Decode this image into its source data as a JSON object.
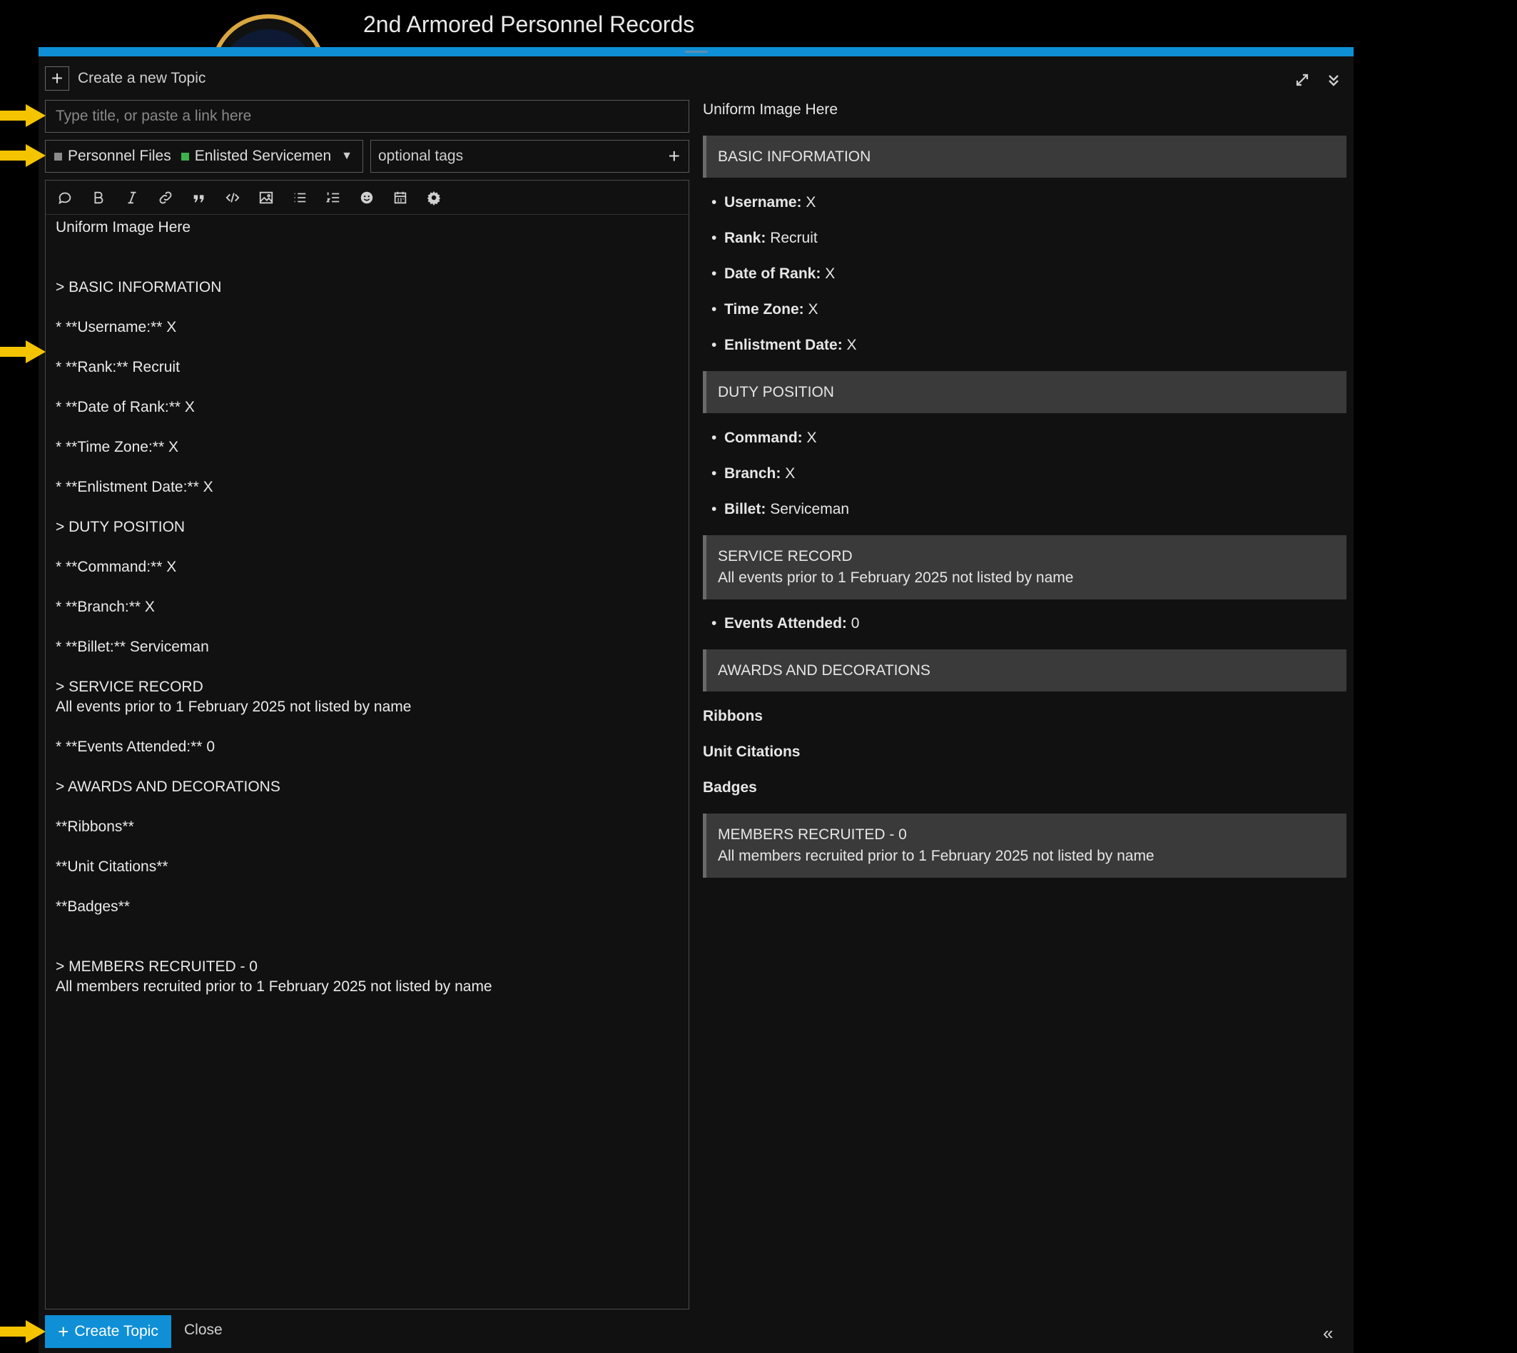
{
  "site": {
    "title": "2nd Armored Personnel Records"
  },
  "composer": {
    "action_label": "Create a new Topic",
    "title_placeholder": "Type title, or paste a link here",
    "category": {
      "parent": "Personnel Files",
      "child": "Enlisted Servicemen",
      "parent_color": "#8a8a8a",
      "child_color": "#3cb34a"
    },
    "tags_placeholder": "optional tags",
    "toolbar_icons": [
      "quote-icon",
      "bold-icon",
      "italic-icon",
      "link-icon",
      "blockquote-icon",
      "code-icon",
      "image-icon",
      "bullet-list-icon",
      "numbered-list-icon",
      "emoji-icon",
      "calendar-icon",
      "gear-icon"
    ],
    "editor_text": "Uniform Image Here\n\n\n> BASIC INFORMATION\n\n* **Username:** X\n\n* **Rank:** Recruit\n\n* **Date of Rank:** X\n\n* **Time Zone:** X\n\n* **Enlistment Date:** X\n\n> DUTY POSITION\n\n* **Command:** X\n\n* **Branch:** X\n\n* **Billet:** Serviceman\n\n> SERVICE RECORD\nAll events prior to 1 February 2025 not listed by name\n\n* **Events Attended:** 0\n\n> AWARDS AND DECORATIONS\n\n**Ribbons**\n\n**Unit Citations**\n\n**Badges**\n\n\n> MEMBERS RECRUITED - 0\nAll members recruited prior to 1 February 2025 not listed by name",
    "create_label": "Create Topic",
    "close_label": "Close"
  },
  "preview": {
    "intro": "Uniform Image Here",
    "basic_header": "BASIC INFORMATION",
    "basic_items": [
      {
        "label": "Username:",
        "value": "X"
      },
      {
        "label": "Rank:",
        "value": "Recruit"
      },
      {
        "label": "Date of Rank:",
        "value": "X"
      },
      {
        "label": "Time Zone:",
        "value": "X"
      },
      {
        "label": "Enlistment Date:",
        "value": "X"
      }
    ],
    "duty_header": "DUTY POSITION",
    "duty_items": [
      {
        "label": "Command:",
        "value": "X"
      },
      {
        "label": "Branch:",
        "value": "X"
      },
      {
        "label": "Billet:",
        "value": "Serviceman"
      }
    ],
    "service_header": "SERVICE RECORD",
    "service_note": "All events prior to 1 February 2025 not listed by name",
    "service_items": [
      {
        "label": "Events Attended:",
        "value": "0"
      }
    ],
    "awards_header": "AWARDS AND DECORATIONS",
    "award_sections": [
      "Ribbons",
      "Unit Citations",
      "Badges"
    ],
    "recruited_header": "MEMBERS RECRUITED - 0",
    "recruited_note": "All members recruited prior to 1 February 2025 not listed by name"
  },
  "colors": {
    "accent": "#0f8fd6",
    "arrow": "#f5c400"
  }
}
